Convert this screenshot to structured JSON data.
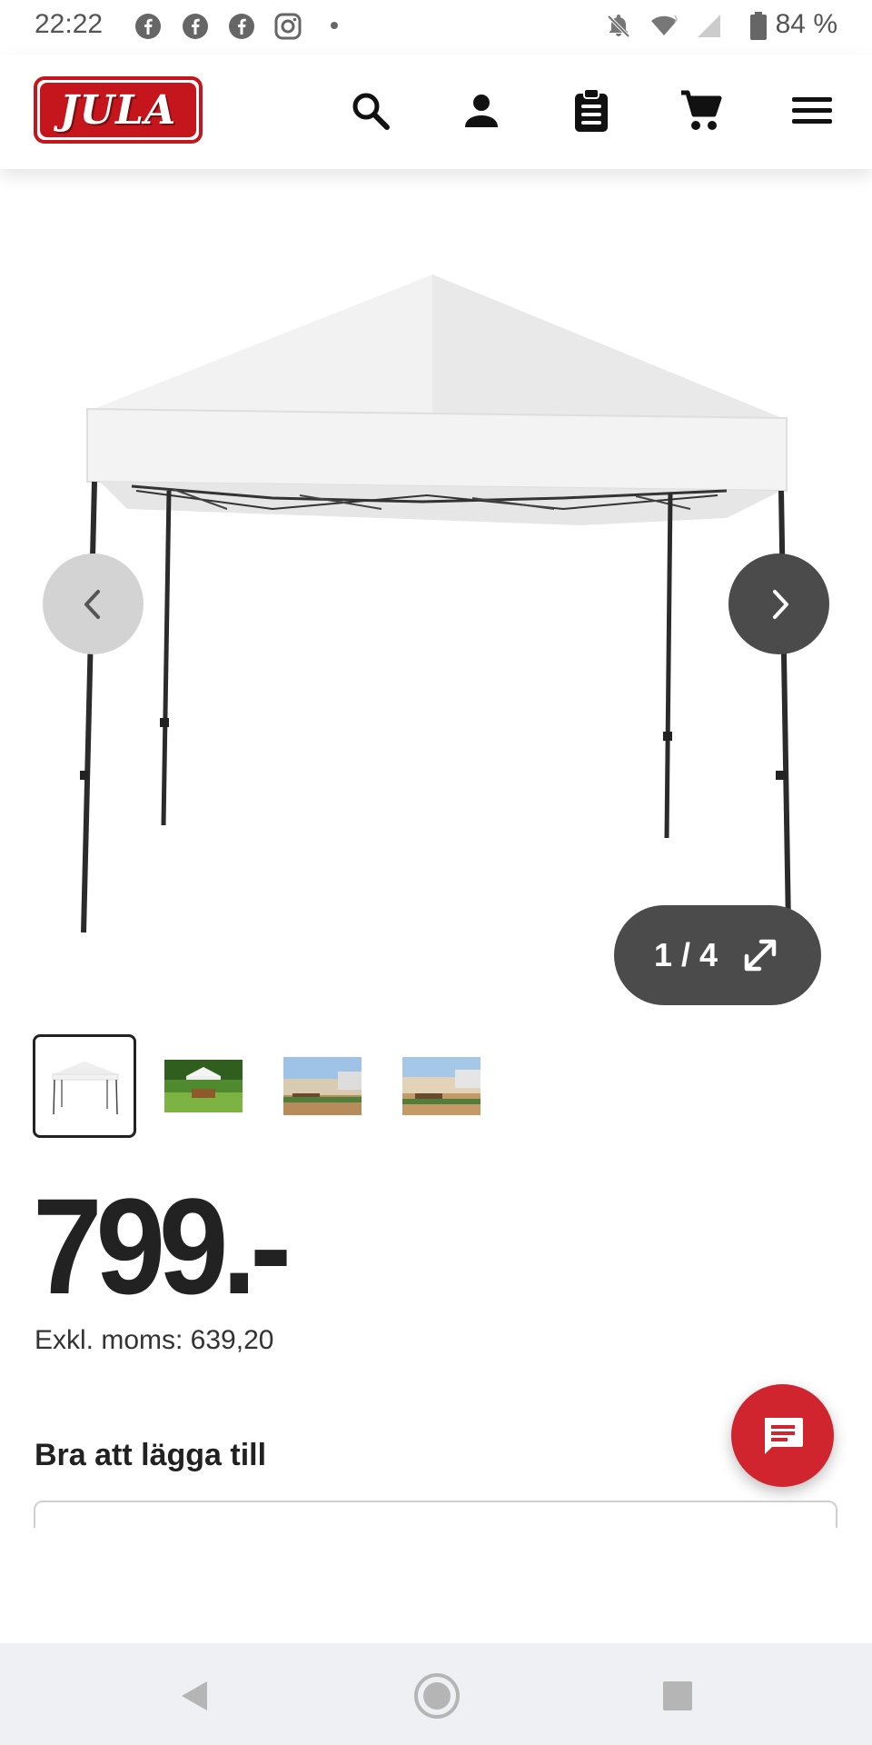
{
  "status_bar": {
    "time": "22:22",
    "battery": "84 %",
    "icons": [
      "facebook-icon",
      "facebook-icon",
      "facebook-icon",
      "instagram-icon",
      "dot-icon",
      "bell-off-icon",
      "wifi-icon",
      "signal-icon",
      "battery-icon"
    ]
  },
  "header": {
    "logo_text": "JULA",
    "icons": [
      "search-icon",
      "account-icon",
      "clipboard-icon",
      "cart-icon",
      "menu-icon"
    ]
  },
  "gallery": {
    "counter": "1 / 4",
    "thumbnails": [
      "thumbnail-1",
      "thumbnail-2",
      "thumbnail-3",
      "thumbnail-4"
    ]
  },
  "product": {
    "price": "799.-",
    "vat_text": "Exkl. moms: 639,20"
  },
  "addons": {
    "title": "Bra att lägga till"
  },
  "colors": {
    "brand_red": "#c4161c",
    "chat_red": "#d0242f",
    "dark_button": "#4b4b4b"
  }
}
